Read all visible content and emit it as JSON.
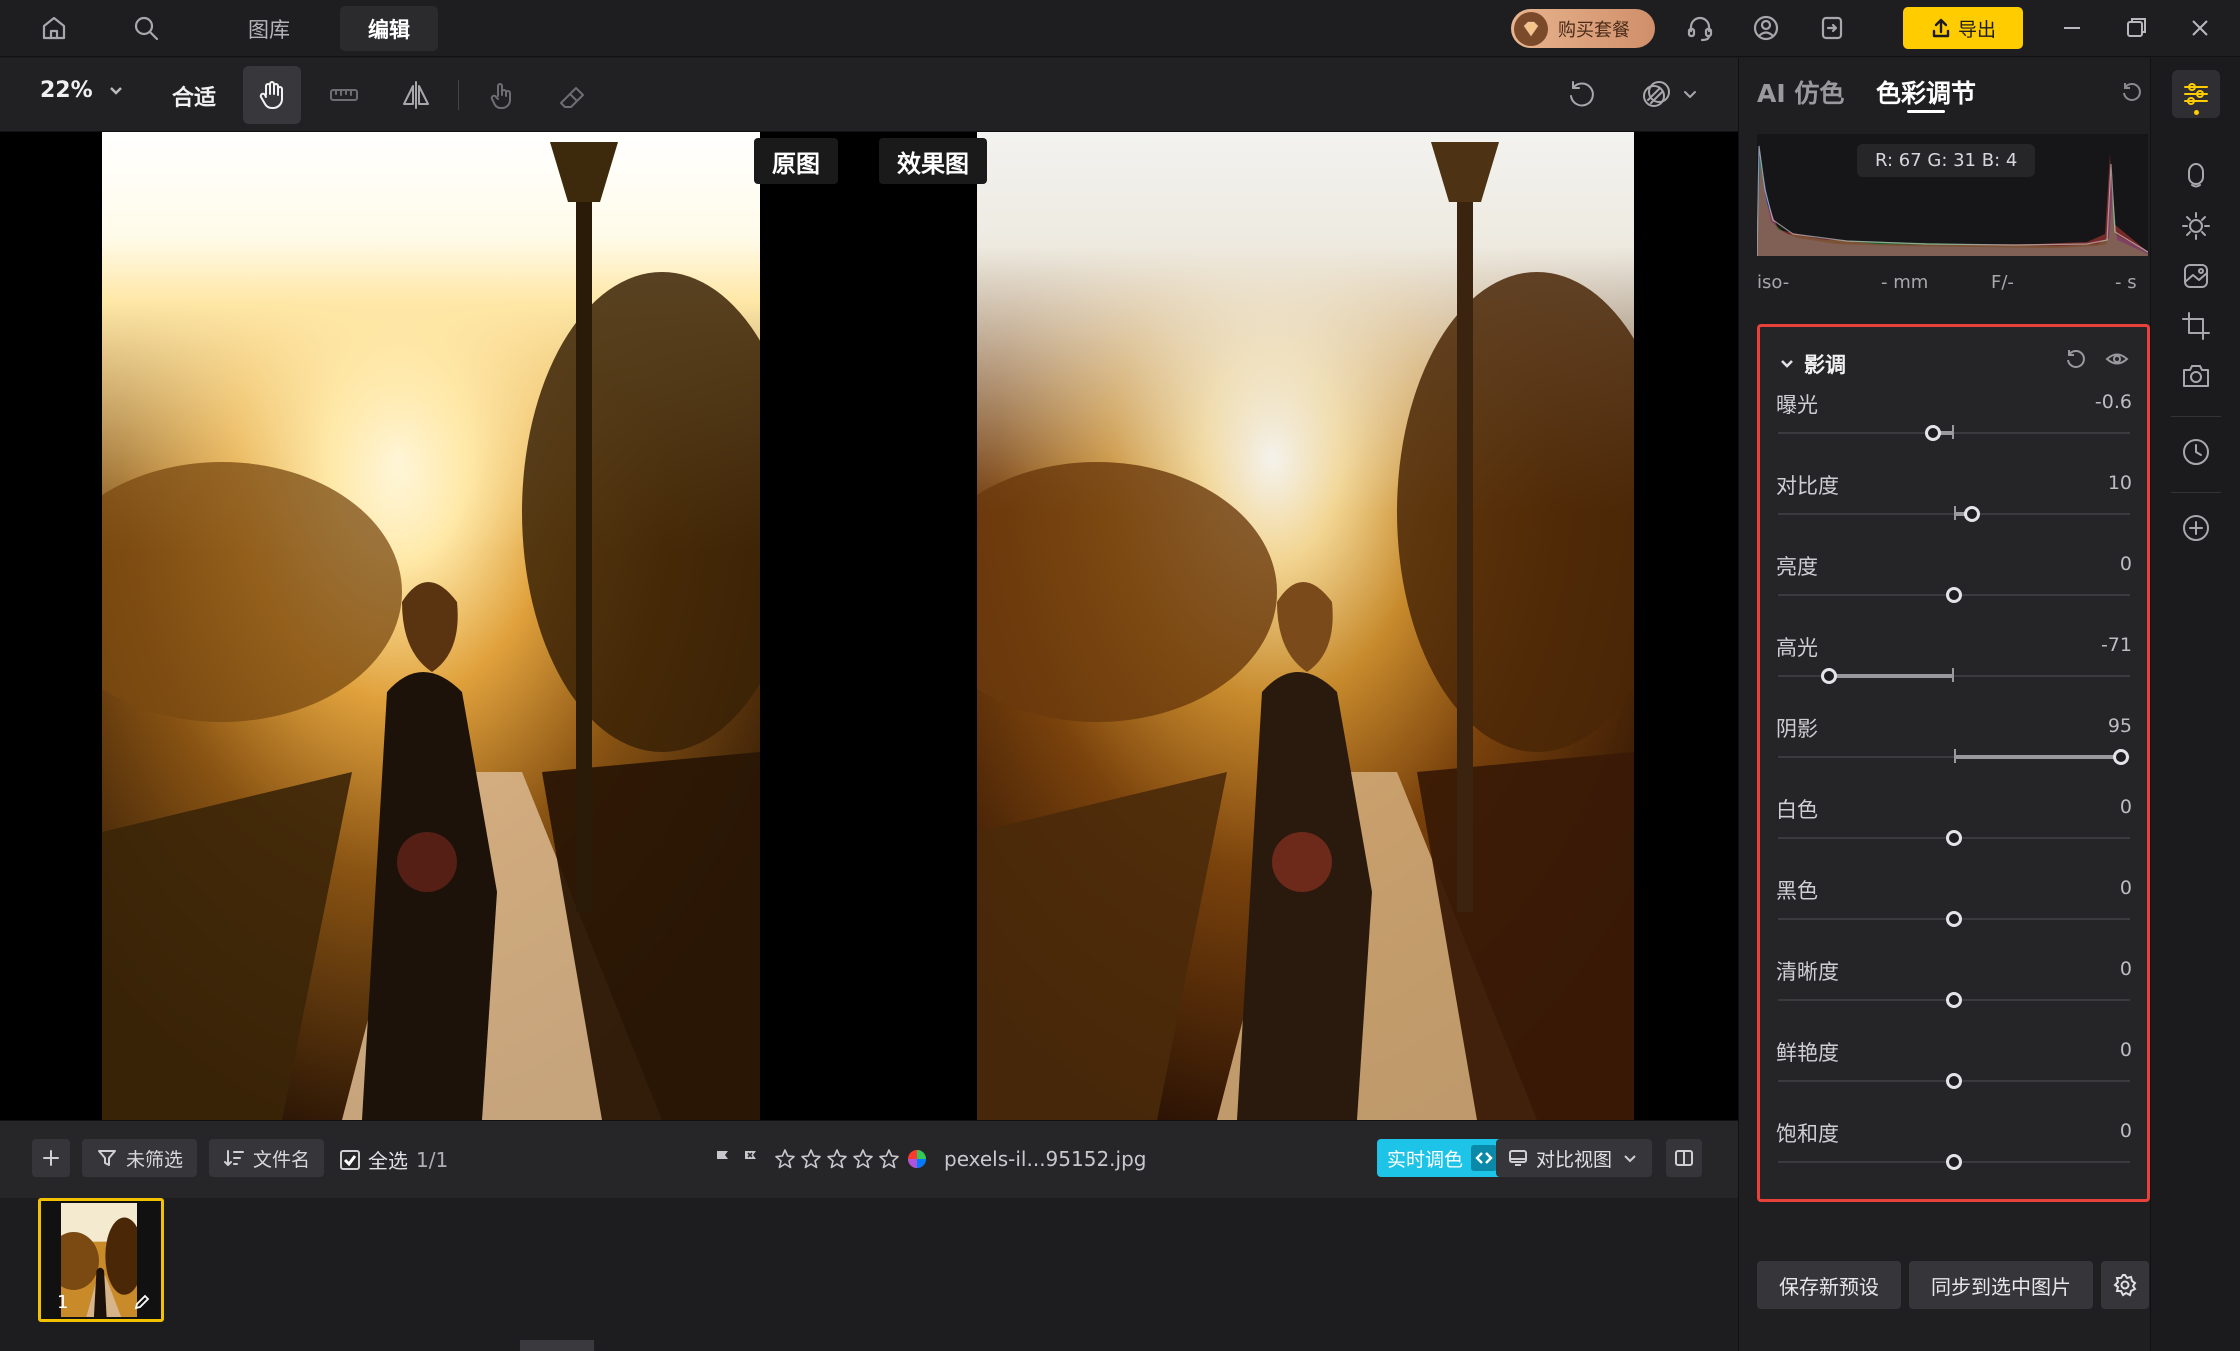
{
  "nav": {
    "tabs": [
      {
        "label": "图库"
      },
      {
        "label": "编辑"
      }
    ],
    "active_tab": "编辑"
  },
  "header": {
    "buy_label": "购买套餐",
    "export_label": "导出"
  },
  "toolbar": {
    "zoom": "22%",
    "fit_label": "合适"
  },
  "compare": {
    "original_label": "原图",
    "result_label": "效果图"
  },
  "filmbar": {
    "filter_label": "未筛选",
    "sort_label": "文件名",
    "select_all_label": "全选",
    "count": "1/1",
    "filename": "pexels-il...95152.jpg",
    "rating_stars": 0,
    "realtime_label": "实时调色",
    "compare_view_label": "对比视图"
  },
  "filmstrip": {
    "items": [
      {
        "index": "1"
      }
    ]
  },
  "right_panel": {
    "tabs": [
      {
        "label": "AI 仿色"
      },
      {
        "label": "色彩调节"
      }
    ],
    "active_tab": "色彩调节",
    "readout": "R: 67  G: 31  B: 4",
    "exif": {
      "iso": "iso-",
      "focal": "- mm",
      "aperture": "F/-",
      "shutter": "- s"
    },
    "tone": {
      "title": "影调",
      "range": [
        -100,
        100
      ],
      "sliders": [
        {
          "label": "曝光",
          "value": "-0.6",
          "level": -0.6,
          "range": [
            -5,
            5
          ]
        },
        {
          "label": "对比度",
          "value": "10",
          "level": 10
        },
        {
          "label": "亮度",
          "value": "0",
          "level": 0
        },
        {
          "label": "高光",
          "value": "-71",
          "level": -71
        },
        {
          "label": "阴影",
          "value": "95",
          "level": 95
        },
        {
          "label": "白色",
          "value": "0",
          "level": 0
        },
        {
          "label": "黑色",
          "value": "0",
          "level": 0
        },
        {
          "label": "清晰度",
          "value": "0",
          "level": 0
        },
        {
          "label": "鲜艳度",
          "value": "0",
          "level": 0
        },
        {
          "label": "饱和度",
          "value": "0",
          "level": 0
        }
      ]
    },
    "save_preset_label": "保存新预设",
    "sync_label": "同步到选中图片"
  },
  "colors": {
    "accent": "#ffcc00",
    "realtime": "#1ec4e8",
    "highlight_border": "#e8413b"
  }
}
